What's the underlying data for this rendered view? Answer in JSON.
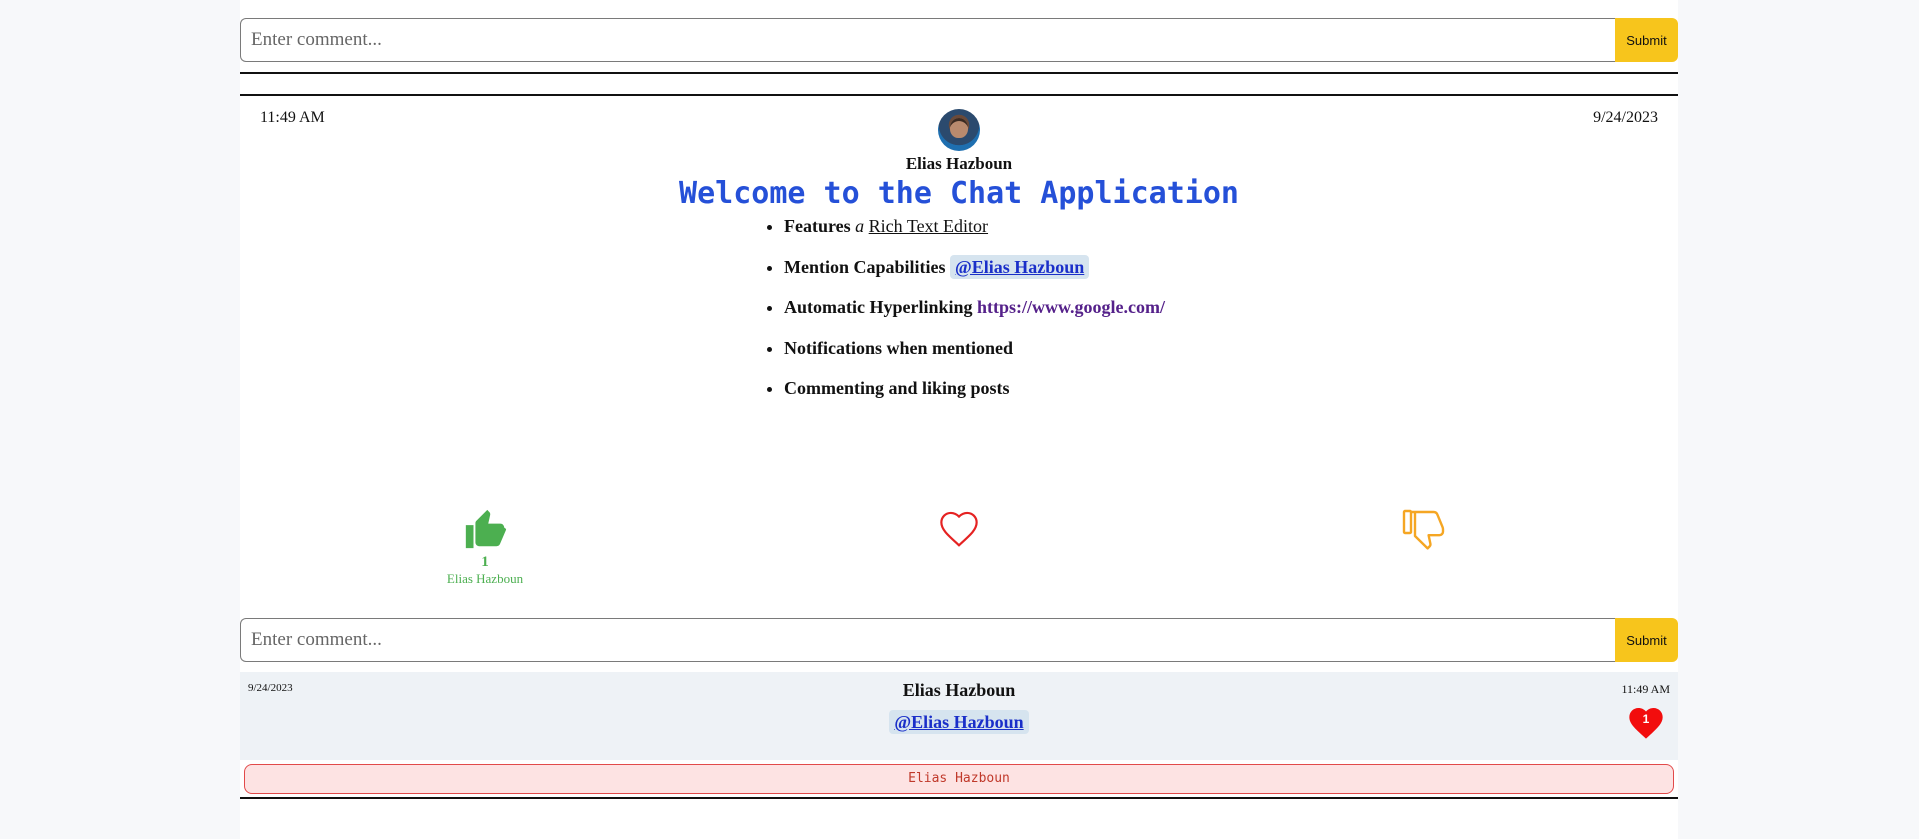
{
  "top_comment": {
    "placeholder": "Enter comment...",
    "submit_label": "Submit"
  },
  "post": {
    "time": "11:49 AM",
    "date": "9/24/2023",
    "author": "Elias Hazboun",
    "title": "Welcome to the Chat Application",
    "features": [
      {
        "bold": "Features",
        "italic": "a",
        "underline": "Rich Text Editor"
      },
      {
        "bold": "Mention Capabilities",
        "mention": "@Elias Hazboun"
      },
      {
        "bold": "Automatic Hyperlinking",
        "link": "https://www.google.com/"
      },
      {
        "bold": "Notifications when mentioned"
      },
      {
        "bold": "Commenting and liking posts"
      }
    ],
    "reactions": {
      "like_count": "1",
      "like_user": "Elias Hazboun",
      "like_color": "#4caf50",
      "heart_color": "#e52222",
      "dislike_color": "#f5a623"
    }
  },
  "bottom_comment": {
    "placeholder": "Enter comment...",
    "submit_label": "Submit"
  },
  "comment": {
    "date": "9/24/2023",
    "time": "11:49 AM",
    "author": "Elias Hazboun",
    "mention": "@Elias Hazboun",
    "heart_count": "1"
  },
  "notice": {
    "text": "Elias Hazboun"
  },
  "colors": {
    "accent": "#f7c51c",
    "title": "#2550d8",
    "mention_bg": "#d6e4ef"
  }
}
